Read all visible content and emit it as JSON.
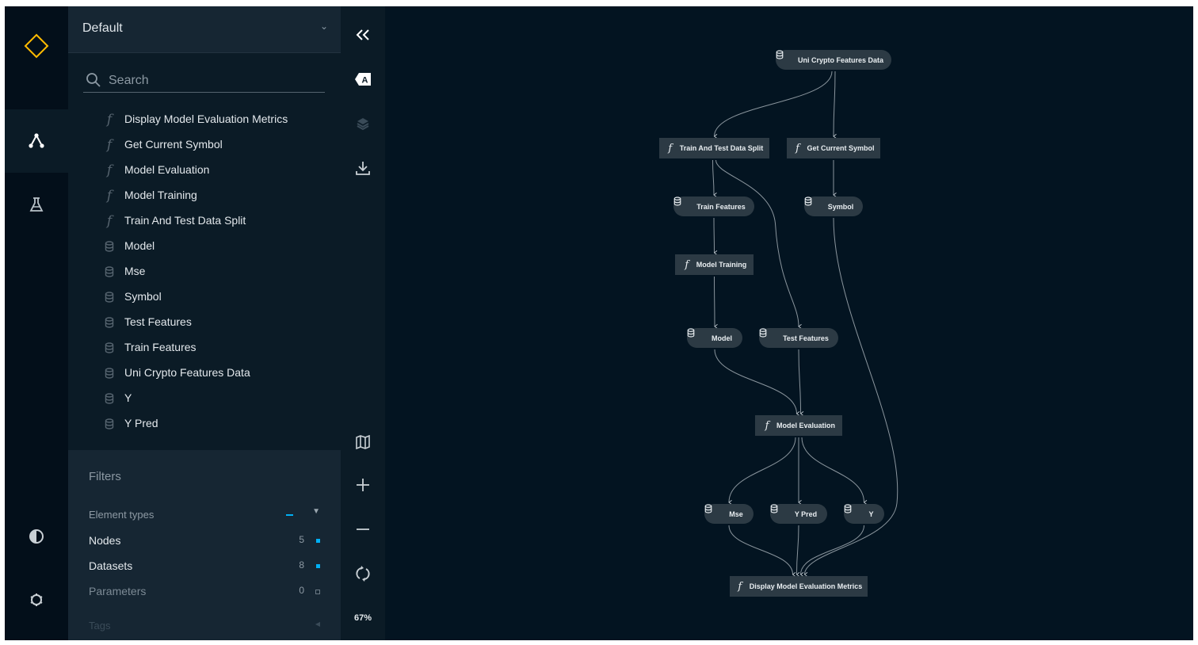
{
  "colors": {
    "accent_yellow": "#ffbc00",
    "accent_blue": "#00b0f5",
    "nav_bg": "#030f1a",
    "panel_bg": "#0b1b26",
    "canvas_bg": "#031421",
    "node_bg": "#2c3a44"
  },
  "global_nav": {
    "logo_icon": "diamond-logo-icon",
    "items": [
      {
        "name": "flowchart",
        "icon": "flowchart-icon",
        "active": true
      },
      {
        "name": "experiments",
        "icon": "flask-icon",
        "active": false
      }
    ],
    "bottom": [
      {
        "name": "theme-toggle",
        "icon": "contrast-icon"
      },
      {
        "name": "settings",
        "icon": "gear-icon"
      }
    ]
  },
  "sidebar": {
    "pipeline": "Default",
    "search_placeholder": "Search",
    "items": [
      {
        "type": "task",
        "label": "Display Model Evaluation Metrics"
      },
      {
        "type": "task",
        "label": "Get Current Symbol"
      },
      {
        "type": "task",
        "label": "Model Evaluation"
      },
      {
        "type": "task",
        "label": "Model Training"
      },
      {
        "type": "task",
        "label": "Train And Test Data Split"
      },
      {
        "type": "dataset",
        "label": "Model"
      },
      {
        "type": "dataset",
        "label": "Mse"
      },
      {
        "type": "dataset",
        "label": "Symbol"
      },
      {
        "type": "dataset",
        "label": "Test Features"
      },
      {
        "type": "dataset",
        "label": "Train Features"
      },
      {
        "type": "dataset",
        "label": "Uni Crypto Features Data"
      },
      {
        "type": "dataset",
        "label": "Y"
      },
      {
        "type": "dataset",
        "label": "Y Pred"
      }
    ],
    "filters": {
      "title": "Filters",
      "group_label": "Element types",
      "rows": [
        {
          "label": "Nodes",
          "count": "5",
          "checked": true
        },
        {
          "label": "Datasets",
          "count": "8",
          "checked": true
        },
        {
          "label": "Parameters",
          "count": "0",
          "checked": false
        }
      ],
      "tags_label": "Tags"
    }
  },
  "toolbar": {
    "collapse": "collapse-icon",
    "labels_toggle": "labels-icon",
    "layers": "layers-icon",
    "export": "download-icon",
    "minimap": "map-icon",
    "zoom_in": "plus-icon",
    "zoom_out": "minus-icon",
    "reset": "refresh-icon",
    "zoom_level": "67%"
  },
  "graph": {
    "nodes": [
      {
        "id": "uni",
        "type": "dataset",
        "label": "Uni Crypto Features Data"
      },
      {
        "id": "split",
        "type": "task",
        "label": "Train And Test Data Split"
      },
      {
        "id": "getsym",
        "type": "task",
        "label": "Get Current Symbol"
      },
      {
        "id": "trainf",
        "type": "dataset",
        "label": "Train Features"
      },
      {
        "id": "symbol",
        "type": "dataset",
        "label": "Symbol"
      },
      {
        "id": "mtrain",
        "type": "task",
        "label": "Model Training"
      },
      {
        "id": "model",
        "type": "dataset",
        "label": "Model"
      },
      {
        "id": "testf",
        "type": "dataset",
        "label": "Test Features"
      },
      {
        "id": "meval",
        "type": "task",
        "label": "Model Evaluation"
      },
      {
        "id": "mse",
        "type": "dataset",
        "label": "Mse"
      },
      {
        "id": "ypred",
        "type": "dataset",
        "label": "Y Pred"
      },
      {
        "id": "y",
        "type": "dataset",
        "label": "Y"
      },
      {
        "id": "display",
        "type": "task",
        "label": "Display Model Evaluation Metrics"
      }
    ],
    "edges": [
      [
        "uni",
        "split"
      ],
      [
        "uni",
        "getsym"
      ],
      [
        "split",
        "trainf"
      ],
      [
        "split",
        "testf"
      ],
      [
        "getsym",
        "symbol"
      ],
      [
        "trainf",
        "mtrain"
      ],
      [
        "mtrain",
        "model"
      ],
      [
        "model",
        "meval"
      ],
      [
        "testf",
        "meval"
      ],
      [
        "meval",
        "mse"
      ],
      [
        "meval",
        "ypred"
      ],
      [
        "meval",
        "y"
      ],
      [
        "mse",
        "display"
      ],
      [
        "ypred",
        "display"
      ],
      [
        "y",
        "display"
      ],
      [
        "symbol",
        "display"
      ]
    ]
  }
}
